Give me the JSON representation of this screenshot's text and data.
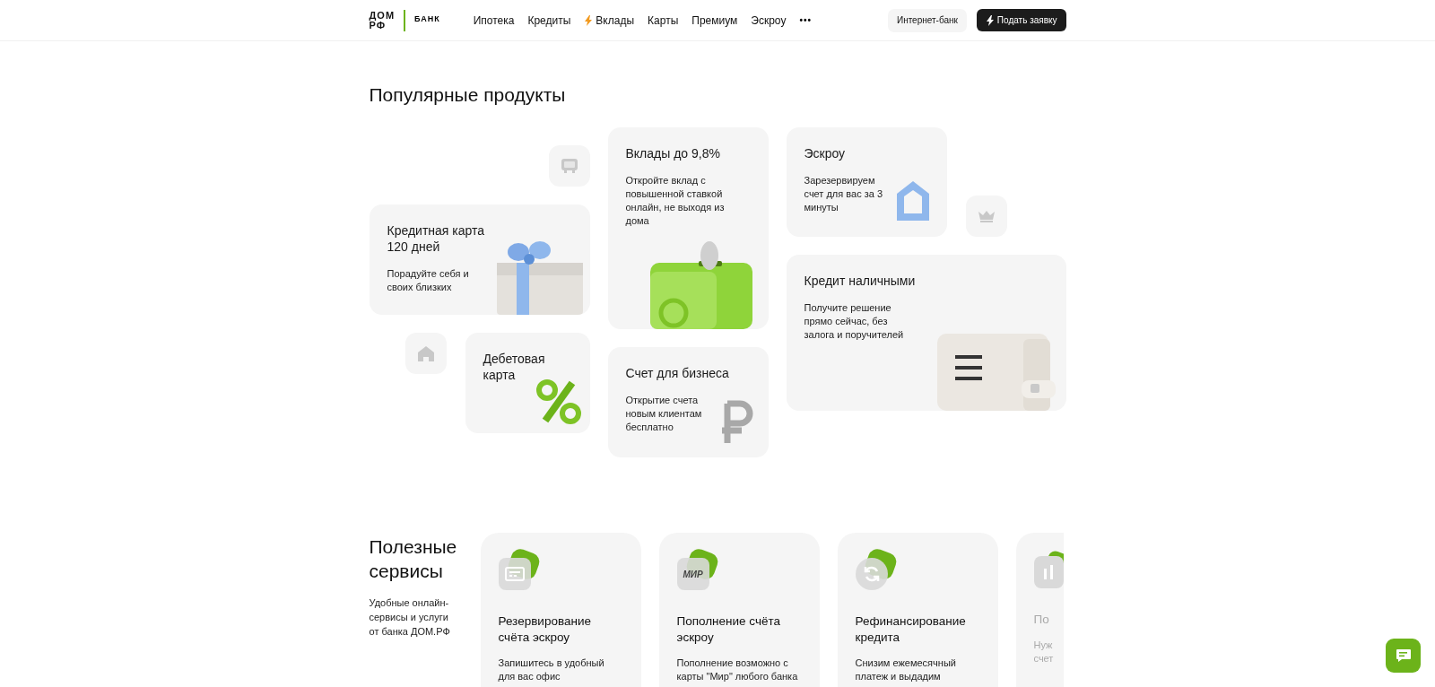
{
  "header": {
    "logo": {
      "top": "ДОМ",
      "bottom": "РФ",
      "bank": "БАНК"
    },
    "nav": [
      {
        "label": "Ипотека",
        "bolt": false
      },
      {
        "label": "Кредиты",
        "bolt": false
      },
      {
        "label": "Вклады",
        "bolt": true
      },
      {
        "label": "Карты",
        "bolt": false
      },
      {
        "label": "Премиум",
        "bolt": false
      },
      {
        "label": "Эскроу",
        "bolt": false
      }
    ],
    "more": "•••",
    "internet_bank": "Интернет-банк",
    "apply": "Подать заявку"
  },
  "products": {
    "title": "Популярные продукты",
    "tiles": [
      {
        "kind": "screen"
      },
      {
        "kind": "home"
      },
      {
        "kind": "crown"
      }
    ],
    "cards": [
      {
        "kind": "gift",
        "title": "Кредитная карта 120 дней",
        "text": "Порадуйте себя и своих близких"
      },
      {
        "kind": "percent",
        "title": "Дебетовая карта"
      },
      {
        "kind": "safe",
        "title": "Вклады до 9,8%",
        "text": "Откройте вклад с повышенной ставкой онлайн, не выходя из дома"
      },
      {
        "kind": "ruble",
        "title": "Счет для бизнеса",
        "text": "Открытие счета новым клиентам бесплатно"
      },
      {
        "kind": "house",
        "title": "Эскроу",
        "text": "Зарезервируем счет для вас за 3 минуты"
      },
      {
        "kind": "wallet",
        "title": "Кредит наличными",
        "text": "Получите решение прямо сейчас, без залога и поручителей"
      }
    ]
  },
  "services": {
    "title": "Полезные сервисы",
    "text": "Удобные онлайн-сервисы и услуги от банка ДОМ.РФ",
    "cards": [
      {
        "kind": "terminal",
        "title": "Резервирование счёта эскроу",
        "text": "Запишитесь в удобный для вас офис"
      },
      {
        "kind": "card",
        "badge": "МИР",
        "title": "Пополнение счёта эскроу",
        "text": "Пополнение возможно с карты \"Мир\" любого банка"
      },
      {
        "kind": "refresh",
        "title": "Рефинансирование кредита",
        "text": "Снизим ежемесячный платеж и выдадим"
      },
      {
        "kind": "chart",
        "title": "По",
        "text_lines": [
          "Нуж",
          "счет"
        ]
      }
    ]
  }
}
